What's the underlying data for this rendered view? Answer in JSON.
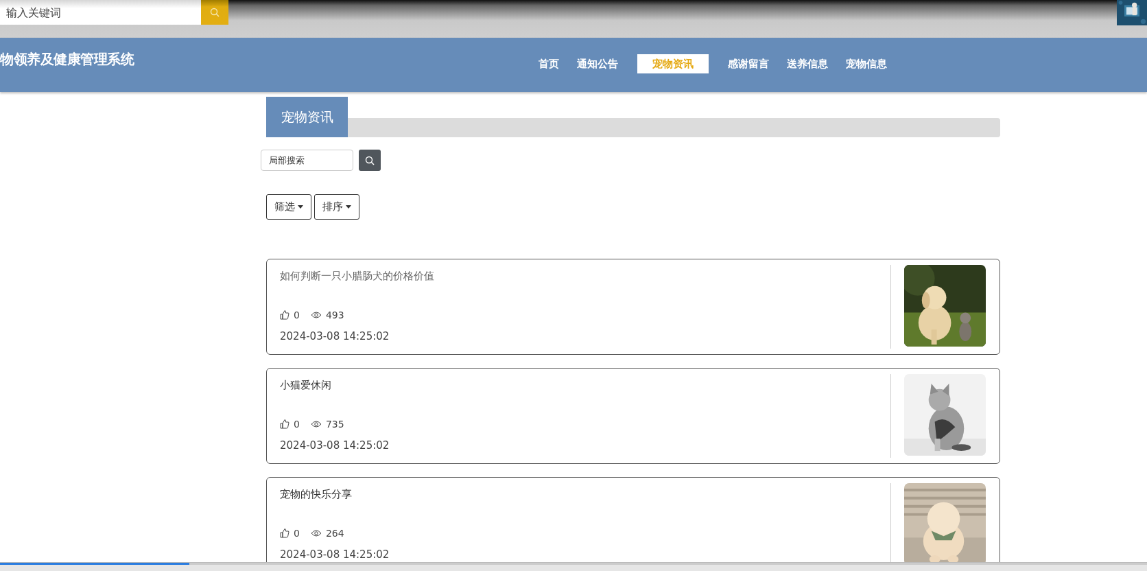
{
  "top_search": {
    "placeholder": "输入关键词"
  },
  "header": {
    "title": "物领养及健康管理系统"
  },
  "nav": [
    {
      "label": "首页",
      "selected": false
    },
    {
      "label": "通知公告",
      "selected": false
    },
    {
      "label": "宠物资讯",
      "selected": true
    },
    {
      "label": "感谢留言",
      "selected": false
    },
    {
      "label": "送养信息",
      "selected": false
    },
    {
      "label": "宠物信息",
      "selected": false
    }
  ],
  "section": {
    "title": "宠物资讯"
  },
  "local_search": {
    "placeholder": "局部搜索"
  },
  "dropdowns": [
    {
      "label": "筛选"
    },
    {
      "label": "排序"
    }
  ],
  "articles": [
    {
      "title": "如何判断一只小腊肠犬的价格价值",
      "hovered": true,
      "likes": "0",
      "views": "493",
      "date": "2024-03-08 14:25:02"
    },
    {
      "title": "小猫爱休闲",
      "hovered": false,
      "likes": "0",
      "views": "735",
      "date": "2024-03-08 14:25:02"
    },
    {
      "title": "宠物的快乐分享",
      "hovered": false,
      "likes": "0",
      "views": "264",
      "date": "2024-03-08 14:25:02"
    }
  ],
  "player": {
    "level": 0.165
  }
}
